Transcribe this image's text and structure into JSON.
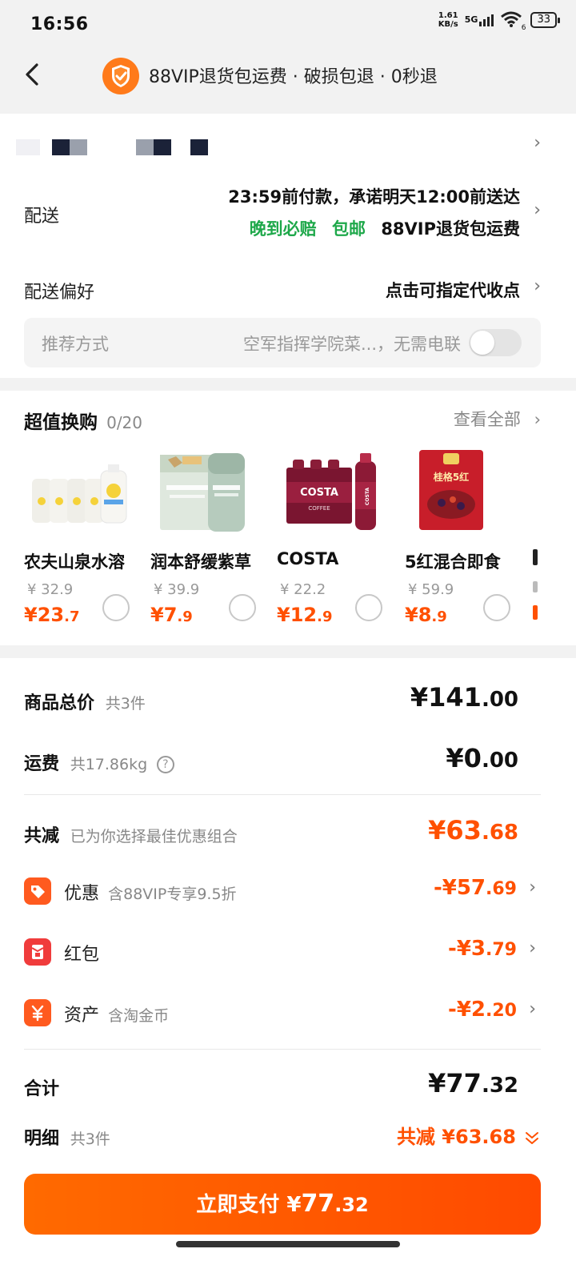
{
  "status_bar": {
    "time": "16:56",
    "net_speed_value": "1.61",
    "net_speed_unit": "KB/s",
    "network": "5G",
    "wifi_sub": "6",
    "battery": "33"
  },
  "header": {
    "title": "88VIP退货包运费 · 破损包退 · 0秒退"
  },
  "delivery": {
    "label": "配送",
    "promise": "23:59前付款，承诺明天12:00前送达",
    "tag_late": "晚到必赔",
    "tag_free": "包邮",
    "tag_vip": "88VIP退货包运费"
  },
  "delivery_pref": {
    "label": "配送偏好",
    "action": "点击可指定代收点",
    "box_label": "推荐方式",
    "box_value": "空军指挥学院菜...，无需电联"
  },
  "swap": {
    "title": "超值换购",
    "count": "0/20",
    "view_all": "查看全部",
    "products": [
      {
        "name": "农夫山泉水溶",
        "orig": "¥ 32.9",
        "price_int": "¥23",
        "price_dec": ".7"
      },
      {
        "name": "润本舒缓紫草",
        "orig": "¥ 39.9",
        "price_int": "¥7",
        "price_dec": ".9"
      },
      {
        "name": "COSTA",
        "orig": "¥ 22.2",
        "price_int": "¥12",
        "price_dec": ".9"
      },
      {
        "name": "5红混合即食",
        "orig": "¥ 59.9",
        "price_int": "¥8",
        "price_dec": ".9"
      }
    ],
    "costa_logo": "COSTA",
    "costa_sub": "COFFEE",
    "oat_logo": "桂格5红"
  },
  "summary": {
    "goods_label": "商品总价",
    "goods_count": "共3件",
    "goods_int": "¥141",
    "goods_dec": ".00",
    "ship_label": "运费",
    "ship_weight": "共17.86kg",
    "ship_int": "¥0",
    "ship_dec": ".00",
    "reduce_label": "共减",
    "reduce_note": "已为你选择最佳优惠组合",
    "reduce_int": "¥63",
    "reduce_dec": ".68",
    "discount_label": "优惠",
    "discount_note": "含88VIP专享9.5折",
    "discount_int": "-¥57",
    "discount_dec": ".69",
    "redpack_label": "红包",
    "redpack_int": "-¥3",
    "redpack_dec": ".79",
    "asset_label": "资产",
    "asset_note": "含淘金币",
    "asset_int": "-¥2",
    "asset_dec": ".20",
    "total_label": "合计",
    "total_int": "¥77",
    "total_dec": ".32",
    "detail_label": "明细",
    "detail_count": "共3件",
    "detail_reduce": "共减 ¥63.68"
  },
  "pay": {
    "label": "立即支付 ¥",
    "int": "77",
    "dec": ".32"
  },
  "colors": {
    "accent": "#ff5000",
    "green": "#1ea84a"
  }
}
